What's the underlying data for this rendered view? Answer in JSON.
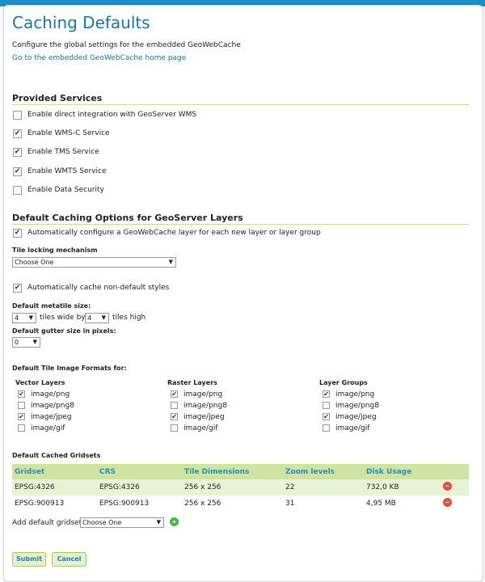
{
  "header": {
    "title": "Caching Defaults",
    "description": "Configure the global settings for the embedded GeoWebCache",
    "home_link": "Go to the embedded GeoWebCache home page"
  },
  "provided_services": {
    "heading": "Provided Services",
    "items": [
      {
        "label": "Enable direct integration with GeoServer WMS",
        "checked": false
      },
      {
        "label": "Enable WMS-C Service",
        "checked": true
      },
      {
        "label": "Enable TMS Service",
        "checked": true
      },
      {
        "label": "Enable WMTS Service",
        "checked": true
      },
      {
        "label": "Enable Data Security",
        "checked": false
      }
    ]
  },
  "caching_options": {
    "heading": "Default Caching Options for GeoServer Layers",
    "auto_configure": {
      "label": "Automatically configure a GeoWebCache layer for each new layer or layer group",
      "checked": true
    },
    "tile_locking_label": "Tile locking mechanism",
    "tile_locking_value": "Choose One",
    "auto_styles": {
      "label": "Automatically cache non-default styles",
      "checked": true
    },
    "metatile_label": "Default metatile size:",
    "metatile_wide": "4",
    "tiles_wide_text": "tiles wide by",
    "metatile_high": "4",
    "tiles_high_text": "tiles high",
    "gutter_label": "Default gutter size in pixels:",
    "gutter_value": "0"
  },
  "image_formats": {
    "heading": "Default Tile Image Formats for:",
    "columns": [
      {
        "title": "Vector Layers",
        "formats": [
          {
            "label": "image/png",
            "checked": true
          },
          {
            "label": "image/png8",
            "checked": false
          },
          {
            "label": "image/jpeg",
            "checked": true
          },
          {
            "label": "image/gif",
            "checked": false
          }
        ]
      },
      {
        "title": "Raster Layers",
        "formats": [
          {
            "label": "image/png",
            "checked": true
          },
          {
            "label": "image/png8",
            "checked": false
          },
          {
            "label": "image/jpeg",
            "checked": true
          },
          {
            "label": "image/gif",
            "checked": false
          }
        ]
      },
      {
        "title": "Layer Groups",
        "formats": [
          {
            "label": "image/png",
            "checked": true
          },
          {
            "label": "image/png8",
            "checked": false
          },
          {
            "label": "image/jpeg",
            "checked": true
          },
          {
            "label": "image/gif",
            "checked": false
          }
        ]
      }
    ]
  },
  "gridsets": {
    "heading": "Default Cached Gridsets",
    "columns": [
      "Gridset",
      "CRS",
      "Tile Dimensions",
      "Zoom levels",
      "Disk Usage"
    ],
    "rows": [
      {
        "gridset": "EPSG:4326",
        "crs": "EPSG:4326",
        "dims": "256 x 256",
        "zoom": "22",
        "disk": "732,0 KB"
      },
      {
        "gridset": "EPSG:900913",
        "crs": "EPSG:900913",
        "dims": "256 x 256",
        "zoom": "31",
        "disk": "4,95 MB"
      }
    ],
    "add_label": "Add default gridset",
    "add_value": "Choose One"
  },
  "buttons": {
    "submit": "Submit",
    "cancel": "Cancel"
  },
  "colors": {
    "accent": "#1677a8",
    "table_header": "#cfe3a3",
    "row_alt": "#e8f2d5",
    "remove": "#e74c3c",
    "add": "#4caf50"
  }
}
